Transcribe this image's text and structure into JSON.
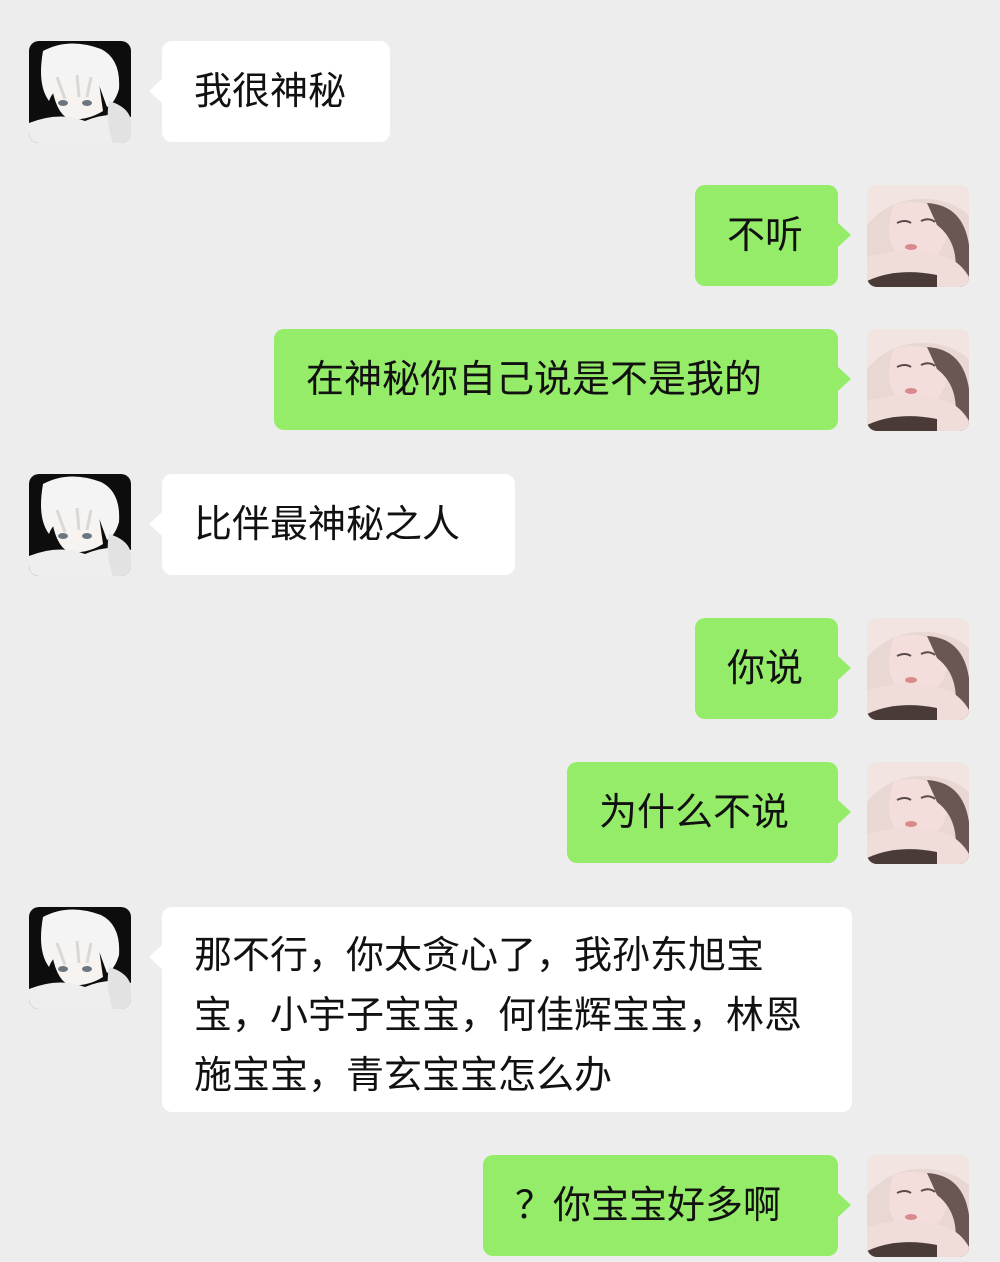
{
  "chat": {
    "messages": [
      {
        "sender": "contact",
        "text": "我很神秘"
      },
      {
        "sender": "self",
        "text": "不听"
      },
      {
        "sender": "self",
        "text": "在神秘你自己说是不是我的"
      },
      {
        "sender": "contact",
        "text": "比伴最神秘之人"
      },
      {
        "sender": "self",
        "text": "你说"
      },
      {
        "sender": "self",
        "text": "为什么不说"
      },
      {
        "sender": "contact",
        "text": "那不行，你太贪心了，我孙东旭宝宝，小宇子宝宝，何佳辉宝宝，林恩施宝宝，青玄宝宝怎么办"
      },
      {
        "sender": "self",
        "text": "？你宝宝好多啊"
      }
    ]
  },
  "colors": {
    "background": "#ededed",
    "incoming_bubble": "#ffffff",
    "outgoing_bubble": "#95ec69",
    "text": "#111111"
  },
  "icons": {
    "contact_avatar": "anime-boy-avatar-icon",
    "self_avatar": "girl-portrait-avatar-icon"
  }
}
